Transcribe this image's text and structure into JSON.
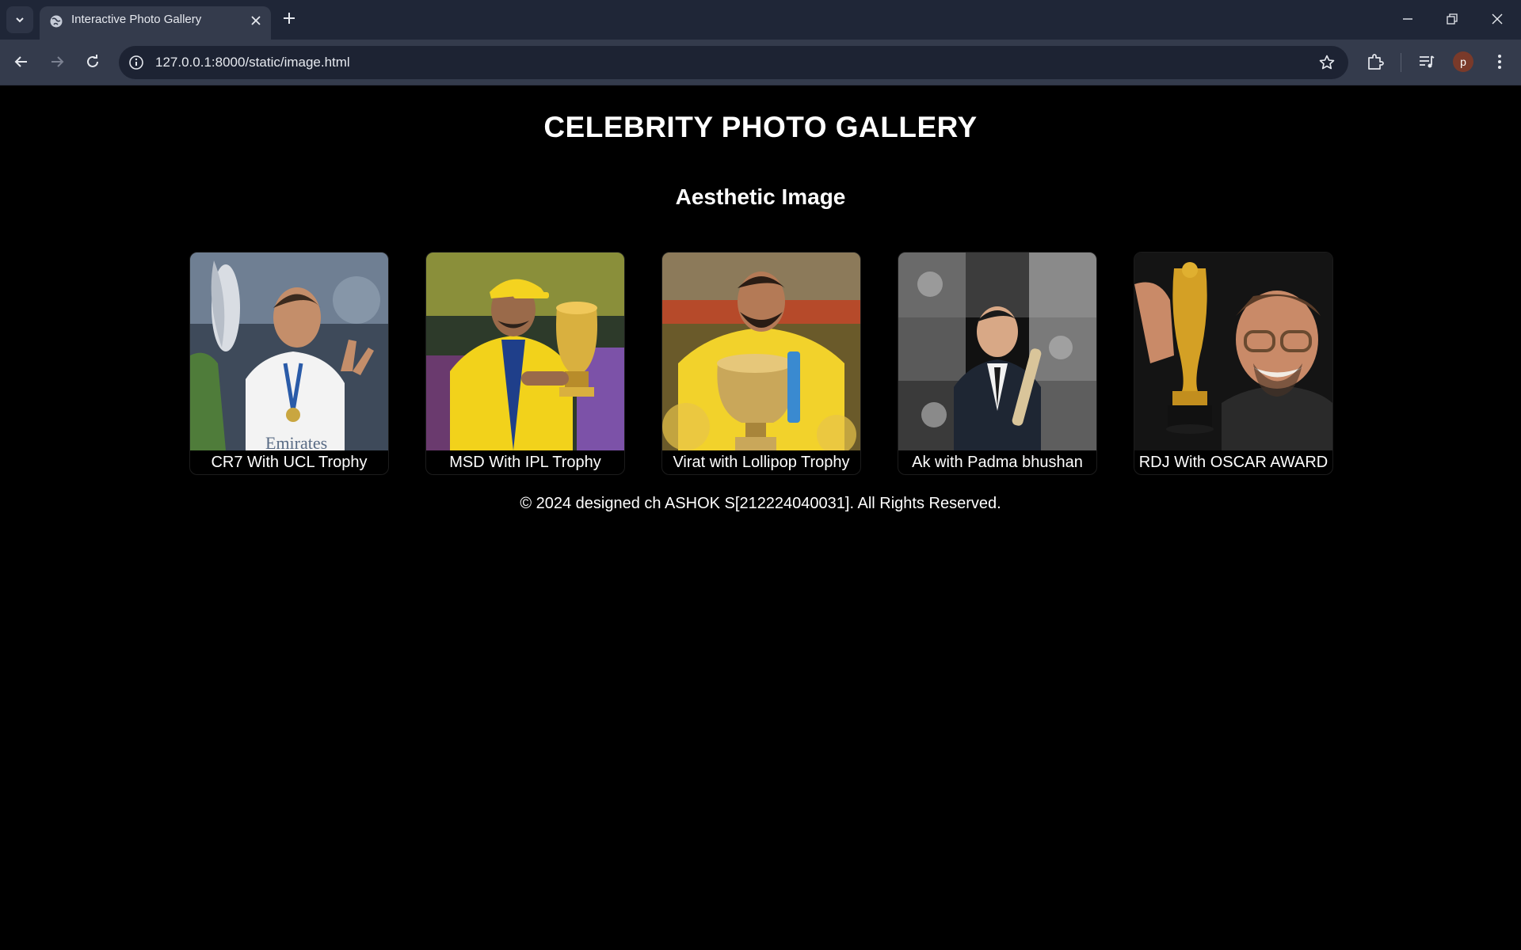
{
  "browser": {
    "tab_title": "Interactive Photo Gallery",
    "url": "127.0.0.1:8000/static/image.html",
    "profile_initial": "p"
  },
  "page": {
    "title": "CELEBRITY PHOTO GALLERY",
    "subtitle": "Aesthetic Image",
    "cards": [
      {
        "caption": "CR7 With UCL Trophy"
      },
      {
        "caption": "MSD With IPL Trophy"
      },
      {
        "caption": "Virat with Lollipop Trophy"
      },
      {
        "caption": "Ak with Padma bhushan"
      },
      {
        "caption": "RDJ With OSCAR AWARD"
      }
    ],
    "footer": "© 2024 designed ch ASHOK S[212224040031]. All Rights Reserved."
  },
  "colors": {
    "chrome_bg": "#1f2637",
    "toolbar_bg": "#343b4c",
    "page_bg": "#000000",
    "text": "#ffffff"
  }
}
